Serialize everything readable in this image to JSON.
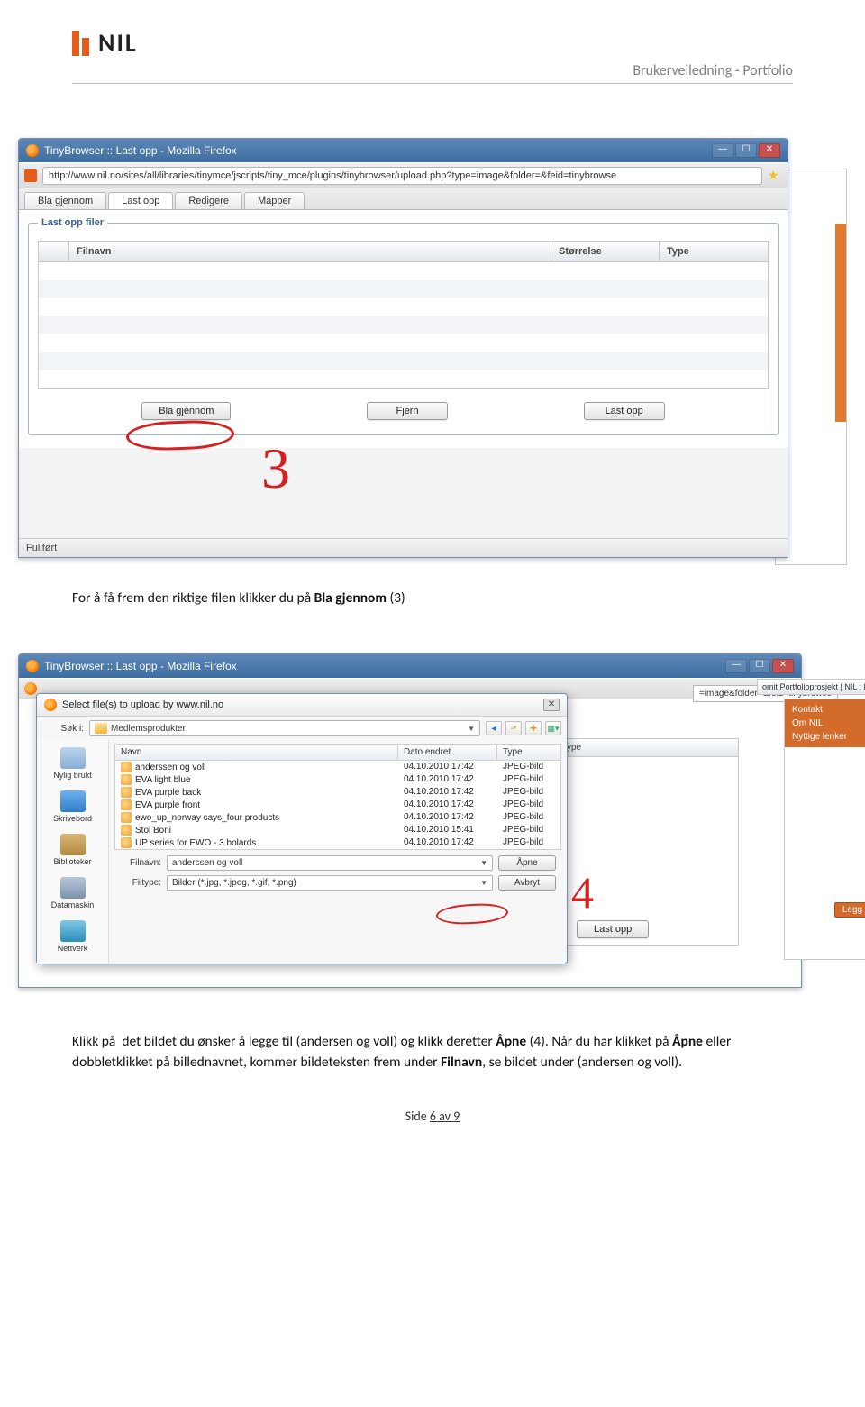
{
  "doc": {
    "logo_text": "NIL",
    "subhead": "Brukerveiledning - Portfolio",
    "page_footer_prefix": "Side ",
    "page_current": "6",
    "page_sep": " av ",
    "page_total": "9"
  },
  "shot1": {
    "window_title": "TinyBrowser :: Last opp - Mozilla Firefox",
    "url": "http://www.nil.no/sites/all/libraries/tinymce/jscripts/tiny_mce/plugins/tinybrowser/upload.php?type=image&folder=&feid=tinybrowse",
    "tabs": [
      "Bla gjennom",
      "Last opp",
      "Redigere",
      "Mapper"
    ],
    "active_tab_index": 1,
    "fieldset_legend": "Last opp filer",
    "grid_headers": {
      "filename": "Filnavn",
      "size": "Størrelse",
      "type": "Type"
    },
    "buttons": {
      "browse": "Bla gjennom",
      "remove": "Fjern",
      "upload": "Last opp"
    },
    "status": "Fullført",
    "annotation": "3"
  },
  "para1": "For å få frem den riktige filen klikker du på Bla gjennom (3)",
  "para1_bold": "Bla gjennom",
  "shot2": {
    "window_title": "TinyBrowser :: Last opp - Mozilla Firefox",
    "url_right_fragment": "=image&folder=&feid=tinybrowse",
    "bg_tab": "omit Portfolioprosjekt | NIL : N...",
    "bg_links": [
      "Kontakt",
      "Om NIL",
      "Nyttige lenker"
    ],
    "legg_btn": "Legg til bilde",
    "tb_under_head": "ype",
    "tb_under_btn": "Last opp",
    "dialog": {
      "title": "Select file(s) to upload by www.nil.no",
      "search_label": "Søk i:",
      "folder_name": "Medlemsprodukter",
      "side": [
        "Nylig brukt",
        "Skrivebord",
        "Biblioteker",
        "Datamaskin",
        "Nettverk"
      ],
      "list_headers": {
        "name": "Navn",
        "date": "Dato endret",
        "type": "Type"
      },
      "files": [
        {
          "name": "anderssen og voll",
          "date": "04.10.2010 17:42",
          "type": "JPEG-bilde"
        },
        {
          "name": "EVA light blue",
          "date": "04.10.2010 17:42",
          "type": "JPEG-bilde"
        },
        {
          "name": "EVA purple back",
          "date": "04.10.2010 17:42",
          "type": "JPEG-bilde"
        },
        {
          "name": "EVA purple front",
          "date": "04.10.2010 17:42",
          "type": "JPEG-bilde"
        },
        {
          "name": "ewo_up_norway says_four products",
          "date": "04.10.2010 17:42",
          "type": "JPEG-bilde"
        },
        {
          "name": "Stol Boni",
          "date": "04.10.2010 15:41",
          "type": "JPEG-bilde"
        },
        {
          "name": "UP series for EWO - 3 bolards",
          "date": "04.10.2010 17:42",
          "type": "JPEG-bilde"
        }
      ],
      "filename_label": "Filnavn:",
      "filename_value": "anderssen og voll",
      "filetype_label": "Filtype:",
      "filetype_value": "Bilder (*.jpg, *.jpeg, *.gif, *.png)",
      "open_btn": "Åpne",
      "cancel_btn": "Avbryt"
    },
    "annotation": "4"
  },
  "para2_full": "Klikk på  det bildet du ønsker å legge til (andersen og voll) og klikk deretter Åpne (4). Når du har klikket på Åpne eller dobbletklikket på billednavnet, kommer bildeteksten frem under Filnavn, se bildet under (andersen og voll)."
}
